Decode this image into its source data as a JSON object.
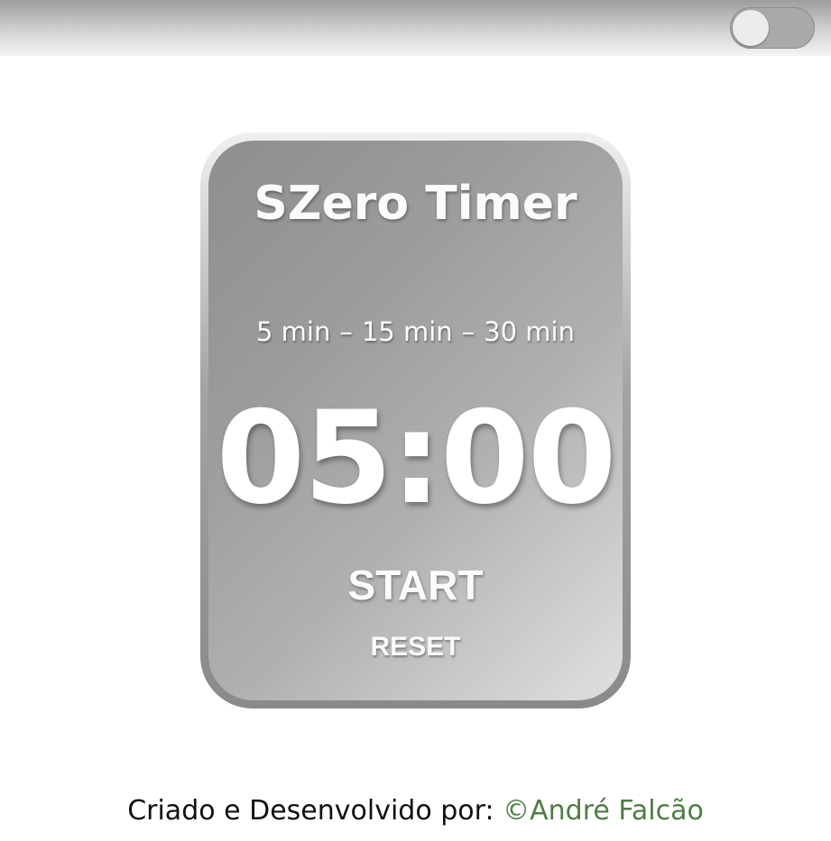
{
  "header": {
    "theme_toggle_state": "off"
  },
  "timer": {
    "title": "SZero Timer",
    "presets": [
      "5 min",
      "15 min",
      "30 min"
    ],
    "separator": "–",
    "display": "05:00",
    "start_label": "START",
    "reset_label": "RESET"
  },
  "footer": {
    "text": "Criado e Desenvolvido por:",
    "author": "©André Falcão"
  },
  "colors": {
    "author_link": "#4e7d45",
    "card_text": "#fbfbfb"
  }
}
